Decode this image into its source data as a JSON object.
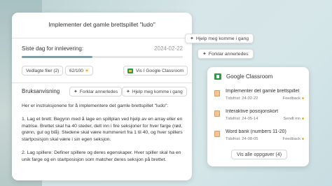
{
  "assignment": {
    "title": "Implementer det gamle brettspillet \"ludo\"",
    "due_label": "Siste dag for innlevering:",
    "due_date": "2024-02-22",
    "progress": 0.44,
    "attachments_label": "Vedlagte filer (2)",
    "score_label": "62/100",
    "classroom_button": "Vis I Google Classroom",
    "section_label": "Bruksanvisning",
    "explain_label": "Forklar annerledes",
    "help_label": "Hjelp meg komme i gang",
    "body": [
      "Her er instruksjonene for å implementere det gamle brettspillet \"ludo\":",
      "1. Lag et brett: Begynn med å lage en spillplan ved hjelp av en array eller en matrise. Brettet skal ha 40 steder, delt inn i fire seksjoner for hver farge (rød, grønn, gul og blå). Stedene skal være nummerert fra 1 til 40, og hver spillers startposisjon skal være i sin egen seksjon.",
      "2. Lag spillere: Definer spillere og deres egenskaper. Hver spiller skal ha en unik farge og en startposisjon som matcher deres seksjon på brettet."
    ]
  },
  "floating": {
    "help_label": "Hjelp meg komme i gang",
    "explain_label": "Forklar annerledes"
  },
  "classroom": {
    "header": "Google Classroom",
    "tasks": [
      {
        "title": "Implementer det gamle brettspillet",
        "deadline": "Tidsfrist: 24-02-22",
        "status": "Feedback",
        "status_color": "#f0b429"
      },
      {
        "title": "Interaktive posisjonskort",
        "deadline": "Tidsfrist: 24-05-14",
        "status": "Sendt inn",
        "status_color": "#f0b429"
      },
      {
        "title": "Word bank (numbers 11-20)",
        "deadline": "Tidsfrist: 24-08-05",
        "status": "Feedback",
        "status_color": "#f0b429"
      }
    ],
    "see_all": "Vis alle oppgaver (4)"
  }
}
